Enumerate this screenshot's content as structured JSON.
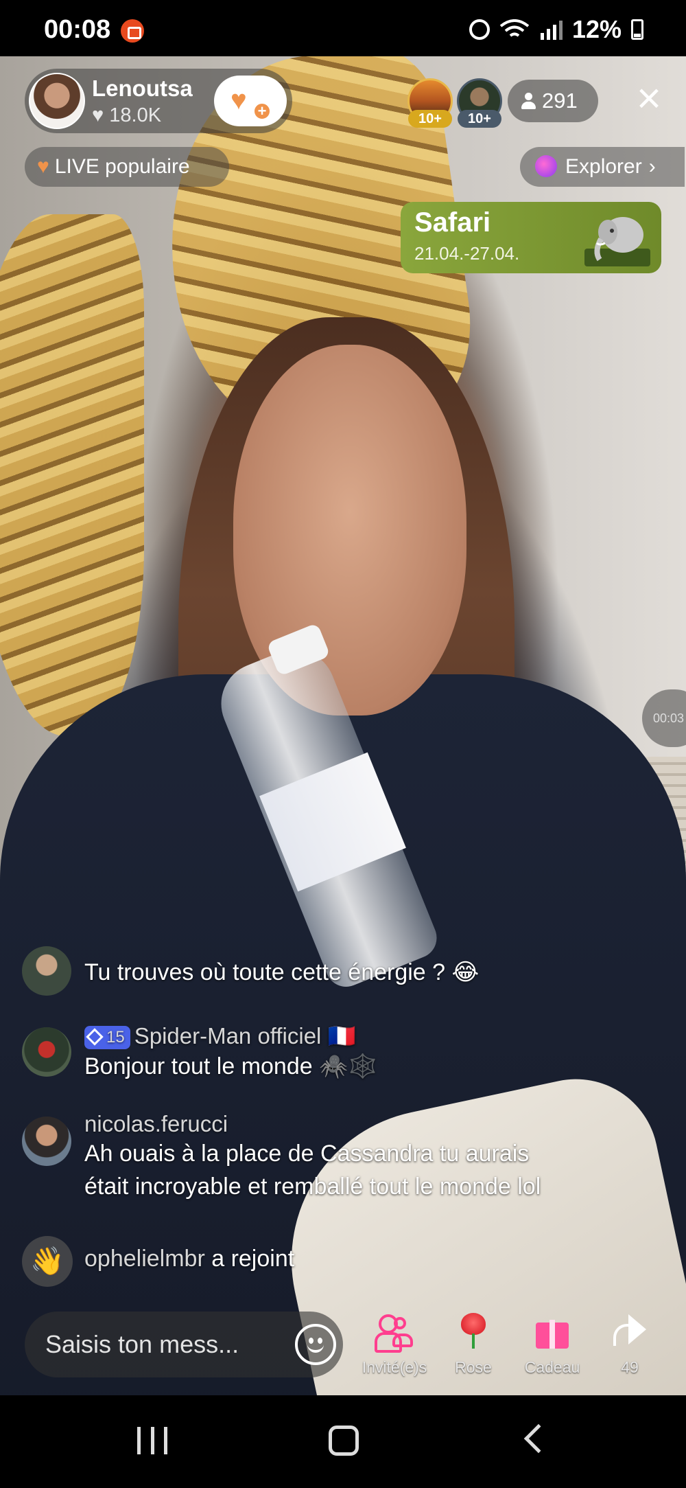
{
  "status_bar": {
    "time": "00:08",
    "battery": "12%"
  },
  "host": {
    "name": "Lenoutsa",
    "likes": "18.0K"
  },
  "viewers": {
    "top_badge_1": "10+",
    "top_badge_2": "10+",
    "count": "291"
  },
  "pills": {
    "popular": "LIVE populaire",
    "explore": "Explorer"
  },
  "event": {
    "title": "Safari",
    "dates": "21.04.-27.04."
  },
  "timer": "00:03",
  "comments": [
    {
      "user": "",
      "text": "Tu trouves où toute cette énergie ? 😂"
    },
    {
      "level": "15",
      "user": "Spider-Man officiel 🇫🇷",
      "text": "Bonjour tout le monde 🕷️🕸️"
    },
    {
      "user": "nicolas.ferucci",
      "text_line1": "Ah ouais à la place de Cassandra tu aurais",
      "text_line2": "était incroyable et remballé tout le monde lol"
    }
  ],
  "join": {
    "user": "ophelielmbr",
    "action": "a rejoint"
  },
  "composer": {
    "placeholder": "Saisis ton mess..."
  },
  "actions": {
    "invite": "Invité(e)s",
    "rose": "Rose",
    "gift": "Cadeau",
    "share_count": "49"
  },
  "colors": {
    "accent_orange": "#f0934a",
    "invite_pink": "#ff3e8e",
    "level_badge": "#4a62e8",
    "event_green": "#7f9a34"
  }
}
